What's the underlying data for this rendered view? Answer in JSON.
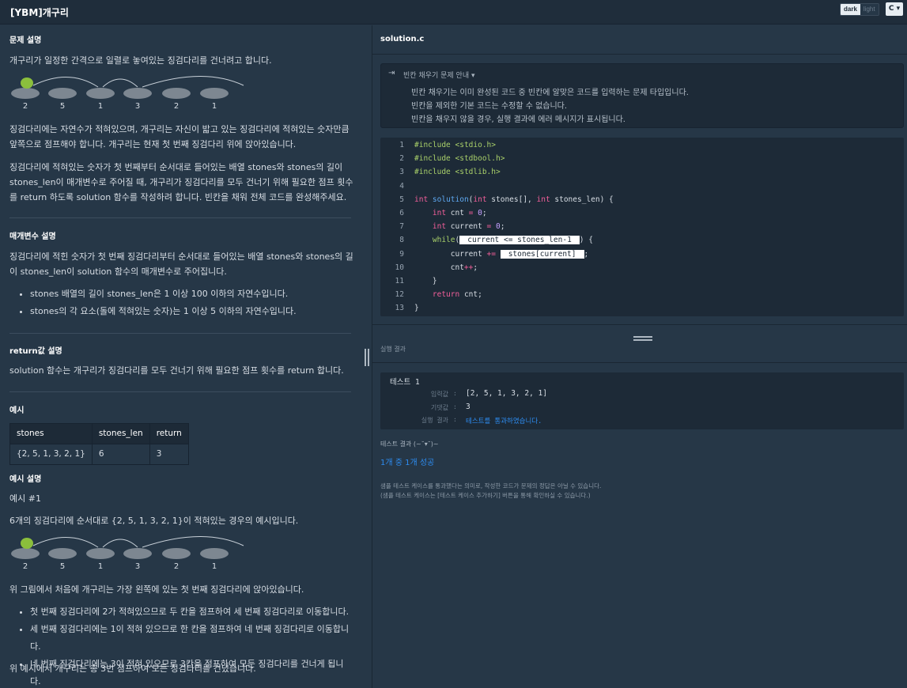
{
  "window": {
    "title": "[YBM]개구리"
  },
  "theme": {
    "dark": "dark",
    "light": "light",
    "lang": "C"
  },
  "problem": {
    "heading": "문제 설명",
    "intro": "개구리가 일정한 간격으로 일렬로 놓여있는 징검다리를 건너려고 합니다.",
    "stones": [
      "2",
      "5",
      "1",
      "3",
      "2",
      "1"
    ],
    "p1": "징검다리에는 자연수가 적혀있으며, 개구리는 자신이 밟고 있는 징검다리에 적혀있는 숫자만큼 앞쪽으로 점프해야 합니다. 개구리는 현재 첫 번째 징검다리 위에 앉아있습니다.",
    "p2": "징검다리에 적혀있는 숫자가 첫 번째부터 순서대로 들어있는 배열 stones와 stones의 길이 stones_len이 매개변수로 주어질 때, 개구리가 징검다리를 모두 건너기 위해 필요한 점프 횟수를 return 하도록 solution 함수를 작성하려 합니다. 빈칸을 채워 전체 코드를 완성해주세요."
  },
  "params": {
    "heading": "매개변수 설명",
    "text": "징검다리에 적힌 숫자가 첫 번째 징검다리부터 순서대로 들어있는 배열 stones와 stones의 길이 stones_len이 solution 함수의 매개변수로 주어집니다.",
    "items": [
      "stones 배열의 길이 stones_len은 1 이상 100 이하의 자연수입니다.",
      "stones의 각 요소(돌에 적혀있는 숫자)는 1 이상 5 이하의 자연수입니다."
    ]
  },
  "returns": {
    "heading": "return값 설명",
    "text": "solution 함수는 개구리가 징검다리를 모두 건너기 위해 필요한 점프 횟수를 return 합니다."
  },
  "example": {
    "heading": "예시",
    "headers": [
      "stones",
      "stones_len",
      "return"
    ],
    "row": [
      "{2, 5, 1, 3, 2, 1}",
      "6",
      "3"
    ]
  },
  "explain": {
    "heading": "예시 설명",
    "sub": "예시 #1",
    "intro": "6개의 징검다리에 순서대로 {2, 5, 1, 3, 2, 1}이 적혀있는 경우의 예시입니다.",
    "after": "위 그림에서 처음에 개구리는 가장 왼쪽에 있는 첫 번째 징검다리에 앉아있습니다.",
    "items": [
      "첫 번째 징검다리에 2가 적혀있으므로 두 칸을 점프하여 세 번째 징검다리로 이동합니다.",
      "세 번째 징검다리에는 1이 적혀 있으므로 한 칸을 점프하여 네 번째 징검다리로 이동합니다.",
      "네 번째 징검다리에는 3이 적혀 있으므로 3칸을 점프하여 모든 징검다리를 건너게 됩니다."
    ],
    "conclusion": "위 예시에서 개구리는 총 3번 점프하여 모든 징검다리를 건넜습니다."
  },
  "editor": {
    "filename": "solution.c",
    "notice_title": "빈칸 채우기 문제 안내",
    "notice_lines": [
      "빈칸 채우기는 이미 완성된 코드 중 빈칸에 알맞은 코드를 입력하는 문제 타입입니다.",
      "빈칸을 제외한 기본 코드는 수정할 수 없습니다.",
      "빈칸을 채우지 않을 경우, 실행 결과에 에러 메시지가 표시됩니다."
    ],
    "line_numbers": [
      "1",
      "2",
      "3",
      "4",
      "5",
      "6",
      "7",
      "8",
      "9",
      "10",
      "11",
      "12",
      "13"
    ],
    "blank1": "current <= stones_len-1",
    "blank2": "stones[current]"
  },
  "result": {
    "label": "실행 결과",
    "test_title": "테스트 1",
    "input_label": "입력값",
    "input_value": "[2, 5, 1, 3, 2, 1]",
    "expected_label": "기댓값",
    "expected_value": "3",
    "result_label": "실행 결과",
    "result_value": "테스트를 통과하였습니다.",
    "summary": "테스트 결과 (~˘▾˘)~",
    "count": "1개 중 1개 성공",
    "note1": "샘플 테스트 케이스를 통과했다는 의미로, 작성한 코드가 문제의 정답은 아닐 수 있습니다.",
    "note2": "(샘플 테스트 케이스는 [테스트 케이스 추가하기] 버튼을 통해 확인하실 수 있습니다.)"
  }
}
